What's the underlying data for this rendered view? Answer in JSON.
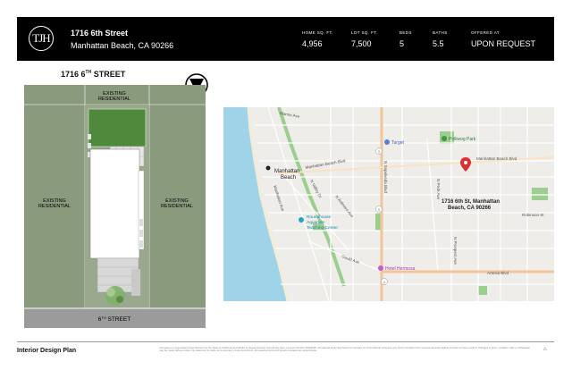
{
  "header": {
    "logo_text": "TJH",
    "address_line1": "1716 6th Street",
    "address_line2": "Manhattan Beach, CA 90266",
    "stats": [
      {
        "label": "HOME SQ. FT.",
        "value": "4,956"
      },
      {
        "label": "LOT SQ. FT.",
        "value": "7,500"
      },
      {
        "label": "BEDS",
        "value": "5"
      },
      {
        "label": "BATHS",
        "value": "5.5"
      },
      {
        "label": "OFFERED AT",
        "value": "UPON REQUEST"
      }
    ]
  },
  "site_plan": {
    "title_prefix": "1716 6",
    "title_sup": "TH",
    "title_suffix": " STREET",
    "north_label": "N",
    "labels": {
      "top": [
        "EXISTING",
        "RESIDENTIAL"
      ],
      "left": [
        "EXISTING",
        "RESIDENTIAL"
      ],
      "right": [
        "EXISTING",
        "RESIDENTIAL"
      ]
    },
    "street_prefix": "6",
    "street_sup": "TH",
    "street_suffix": " STREET"
  },
  "map": {
    "pin_label": [
      "1716 6th St, Manhattan",
      "Beach, CA 90266"
    ],
    "places": {
      "city": [
        "Manhattan",
        "Beach"
      ],
      "target": "Target",
      "polliwog": "Polliwog Park",
      "roundhouse": [
        "Roundhouse",
        "Aquarium",
        "Teaching Center"
      ],
      "hotel": "Hotel Hermosa"
    },
    "streets": {
      "marine": "Marine Ave",
      "mb_blvd_left": "Manhattan Beach Blvd",
      "mb_blvd_right": "Manhattan Beach Blvd",
      "n_sepulveda": "N Sepulveda Blvd",
      "n_peck": "N Peck Ave",
      "n_prospect": "N Prospect Ave",
      "robinson": "Robinson St",
      "artesia": "Artesia Blvd",
      "gould": "Gould Ave",
      "n_valley": "N Valley Dr",
      "manhattan_ave": "Manhattan Ave",
      "n_ardmore": "N Ardmore Ave",
      "shield": "1"
    },
    "colors": {
      "water": "#9fd3e8",
      "park": "#9ccf8f",
      "major_road": "#f3c59a",
      "pin": "#d93232"
    }
  },
  "footer": {
    "title": "Interior Design Plan",
    "fine_print": "Compass is a real estate broker licensed by the State of California and abides by Equal Housing Opportunity laws. License Number 01991628. All material presented herein is intended for informational purposes only and is compiled from sources deemed reliable but has not been verified. Changes in price, condition, sale or withdrawal may be made without notice. No statement is made as to accuracy of any description. All measurements and square footages are approximate.",
    "eho": "⌂"
  }
}
